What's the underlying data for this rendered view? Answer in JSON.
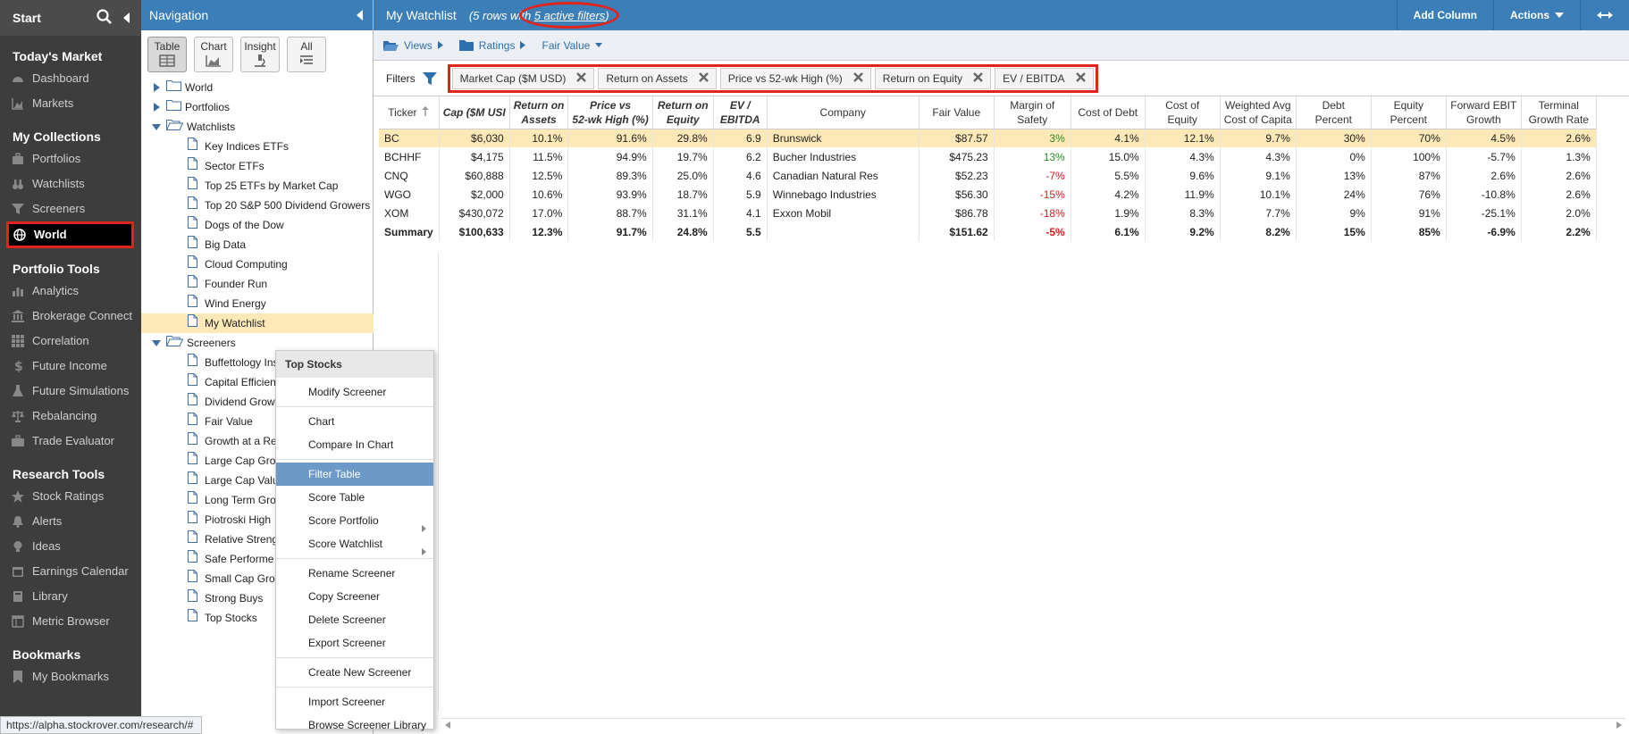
{
  "sidebar": {
    "start_label": "Start",
    "sections": [
      {
        "title": "Today's Market",
        "items": [
          {
            "label": "Dashboard",
            "icon": "dashboard-icon"
          },
          {
            "label": "Markets",
            "icon": "chart-icon"
          }
        ]
      },
      {
        "title": "My Collections",
        "items": [
          {
            "label": "Portfolios",
            "icon": "briefcase-icon"
          },
          {
            "label": "Watchlists",
            "icon": "binoculars-icon"
          },
          {
            "label": "Screeners",
            "icon": "filter-icon"
          },
          {
            "label": "World",
            "icon": "globe-icon",
            "active": true
          }
        ]
      },
      {
        "title": "Portfolio Tools",
        "items": [
          {
            "label": "Analytics",
            "icon": "bar-chart-icon"
          },
          {
            "label": "Brokerage Connect",
            "icon": "bank-icon"
          },
          {
            "label": "Correlation",
            "icon": "grid-icon"
          },
          {
            "label": "Future Income",
            "icon": "dollar-icon"
          },
          {
            "label": "Future Simulations",
            "icon": "flask-icon"
          },
          {
            "label": "Rebalancing",
            "icon": "scale-icon"
          },
          {
            "label": "Trade Evaluator",
            "icon": "toolbox-icon"
          }
        ]
      },
      {
        "title": "Research Tools",
        "items": [
          {
            "label": "Stock Ratings",
            "icon": "star-icon"
          },
          {
            "label": "Alerts",
            "icon": "bell-icon"
          },
          {
            "label": "Ideas",
            "icon": "lightbulb-icon"
          },
          {
            "label": "Earnings Calendar",
            "icon": "calendar-icon"
          },
          {
            "label": "Library",
            "icon": "book-icon"
          },
          {
            "label": "Metric Browser",
            "icon": "window-icon"
          }
        ]
      },
      {
        "title": "Bookmarks",
        "items": [
          {
            "label": "My Bookmarks",
            "icon": "bookmark-icon"
          }
        ]
      }
    ]
  },
  "nav": {
    "title": "Navigation",
    "view_buttons": [
      "Table",
      "Chart",
      "Insight",
      "All"
    ],
    "tree": [
      {
        "label": "World",
        "type": "folder",
        "open": false
      },
      {
        "label": "Portfolios",
        "type": "folder",
        "open": false
      },
      {
        "label": "Watchlists",
        "type": "folder",
        "open": true
      },
      {
        "label": "Key Indices ETFs",
        "type": "leaf"
      },
      {
        "label": "Sector ETFs",
        "type": "leaf"
      },
      {
        "label": "Top 25 ETFs by Market Cap",
        "type": "leaf"
      },
      {
        "label": "Top 20 S&P 500 Dividend Growers",
        "type": "leaf"
      },
      {
        "label": "Dogs of the Dow",
        "type": "leaf"
      },
      {
        "label": "Big Data",
        "type": "leaf"
      },
      {
        "label": "Cloud Computing",
        "type": "leaf"
      },
      {
        "label": "Founder Run",
        "type": "leaf"
      },
      {
        "label": "Wind Energy",
        "type": "leaf"
      },
      {
        "label": "My Watchlist",
        "type": "leaf",
        "selected": true
      },
      {
        "label": "Screeners",
        "type": "folder",
        "open": true
      },
      {
        "label": "Buffettology Ins",
        "type": "leaf"
      },
      {
        "label": "Capital Efficien",
        "type": "leaf"
      },
      {
        "label": "Dividend Grow",
        "type": "leaf"
      },
      {
        "label": "Fair Value",
        "type": "leaf"
      },
      {
        "label": "Growth at a Re",
        "type": "leaf"
      },
      {
        "label": "Large Cap Gro",
        "type": "leaf"
      },
      {
        "label": "Large Cap Valu",
        "type": "leaf"
      },
      {
        "label": "Long Term Gro",
        "type": "leaf"
      },
      {
        "label": "Piotroski High",
        "type": "leaf"
      },
      {
        "label": "Relative Streng",
        "type": "leaf"
      },
      {
        "label": "Safe Performe",
        "type": "leaf"
      },
      {
        "label": "Small Cap Gro",
        "type": "leaf"
      },
      {
        "label": "Strong Buys",
        "type": "leaf"
      },
      {
        "label": "Top Stocks",
        "type": "leaf"
      }
    ]
  },
  "context_menu": {
    "title": "Top Stocks",
    "groups": [
      [
        {
          "label": "Modify Screener"
        }
      ],
      [
        {
          "label": "Chart"
        },
        {
          "label": "Compare In Chart"
        }
      ],
      [
        {
          "label": "Filter Table",
          "highlight": true
        },
        {
          "label": "Score Table"
        },
        {
          "label": "Score Portfolio",
          "submenu": true
        },
        {
          "label": "Score Watchlist",
          "submenu": true
        }
      ],
      [
        {
          "label": "Rename Screener"
        },
        {
          "label": "Copy Screener"
        },
        {
          "label": "Delete Screener"
        },
        {
          "label": "Export Screener"
        }
      ],
      [
        {
          "label": "Create New Screener"
        }
      ],
      [
        {
          "label": "Import Screener"
        },
        {
          "label": "Browse Screener Library"
        }
      ]
    ]
  },
  "main": {
    "title": "My Watchlist",
    "subtitle_prefix": "(5 rows wi",
    "subtitle_mid": "th ",
    "subtitle_link": "5 active filters",
    "subtitle_suffix": ")",
    "add_column": "Add Column",
    "actions": "Actions",
    "views_bar": [
      "Views",
      "Ratings",
      "Fair Value"
    ],
    "filters_label": "Filters",
    "filter_chips": [
      "Market Cap ($M USD)",
      "Return on Assets",
      "Price vs 52-wk High (%)",
      "Return on Equity",
      "EV / EBITDA"
    ],
    "columns": [
      {
        "l1": "Ticker",
        "l2": "",
        "sort": true
      },
      {
        "l1": "Cap ($M USI",
        "l2": "",
        "bi": true
      },
      {
        "l1": "Return on",
        "l2": "Assets",
        "bi": true
      },
      {
        "l1": "Price vs",
        "l2": "52-wk High (%)",
        "bi": true
      },
      {
        "l1": "Return on",
        "l2": "Equity",
        "bi": true
      },
      {
        "l1": "EV /",
        "l2": "EBITDA",
        "bi": true
      },
      {
        "l1": "Company",
        "l2": ""
      },
      {
        "l1": "Fair Value",
        "l2": ""
      },
      {
        "l1": "Margin of",
        "l2": "Safety"
      },
      {
        "l1": "Cost of Debt",
        "l2": ""
      },
      {
        "l1": "Cost of",
        "l2": "Equity"
      },
      {
        "l1": "Weighted Avg",
        "l2": "Cost of Capita"
      },
      {
        "l1": "Debt",
        "l2": "Percent"
      },
      {
        "l1": "Equity",
        "l2": "Percent"
      },
      {
        "l1": "Forward EBIT",
        "l2": "Growth"
      },
      {
        "l1": "Terminal",
        "l2": "Growth Rate"
      }
    ],
    "rows": [
      {
        "cells": [
          "BC",
          "$6,030",
          "10.1%",
          "91.6%",
          "29.8%",
          "6.9",
          "Brunswick",
          "$87.57",
          "3%",
          "4.1%",
          "12.1%",
          "9.7%",
          "30%",
          "70%",
          "4.5%",
          "2.6%"
        ],
        "selected": true,
        "margin_sign": "pos"
      },
      {
        "cells": [
          "BCHHF",
          "$4,175",
          "11.5%",
          "94.9%",
          "19.7%",
          "6.2",
          "Bucher Industries",
          "$475.23",
          "13%",
          "15.0%",
          "4.3%",
          "4.3%",
          "0%",
          "100%",
          "-5.7%",
          "1.3%"
        ],
        "margin_sign": "pos"
      },
      {
        "cells": [
          "CNQ",
          "$60,888",
          "12.5%",
          "89.3%",
          "25.0%",
          "4.6",
          "Canadian Natural Res",
          "$52.23",
          "-7%",
          "5.5%",
          "9.6%",
          "9.1%",
          "13%",
          "87%",
          "2.6%",
          "2.6%"
        ],
        "margin_sign": "neg"
      },
      {
        "cells": [
          "WGO",
          "$2,000",
          "10.6%",
          "93.9%",
          "18.7%",
          "5.9",
          "Winnebago Industries",
          "$56.30",
          "-15%",
          "4.2%",
          "11.9%",
          "10.1%",
          "24%",
          "76%",
          "-10.8%",
          "2.6%"
        ],
        "margin_sign": "neg"
      },
      {
        "cells": [
          "XOM",
          "$430,072",
          "17.0%",
          "88.7%",
          "31.1%",
          "4.1",
          "Exxon Mobil",
          "$86.78",
          "-18%",
          "1.9%",
          "8.3%",
          "7.7%",
          "9%",
          "91%",
          "-25.1%",
          "2.0%"
        ],
        "margin_sign": "neg"
      },
      {
        "cells": [
          "Summary",
          "$100,633",
          "12.3%",
          "91.7%",
          "24.8%",
          "5.5",
          "",
          "$151.62",
          "-5%",
          "6.1%",
          "9.2%",
          "8.2%",
          "15%",
          "85%",
          "-6.9%",
          "2.2%"
        ],
        "summary": true,
        "margin_sign": "neg"
      }
    ]
  },
  "status_url": "https://alpha.stockrover.com/research/#",
  "colors": {
    "header_blue": "#3c7fb8",
    "annotation_red": "#e2231a",
    "selected_row": "#fde9b8",
    "menu_highlight": "#6c99c6"
  }
}
